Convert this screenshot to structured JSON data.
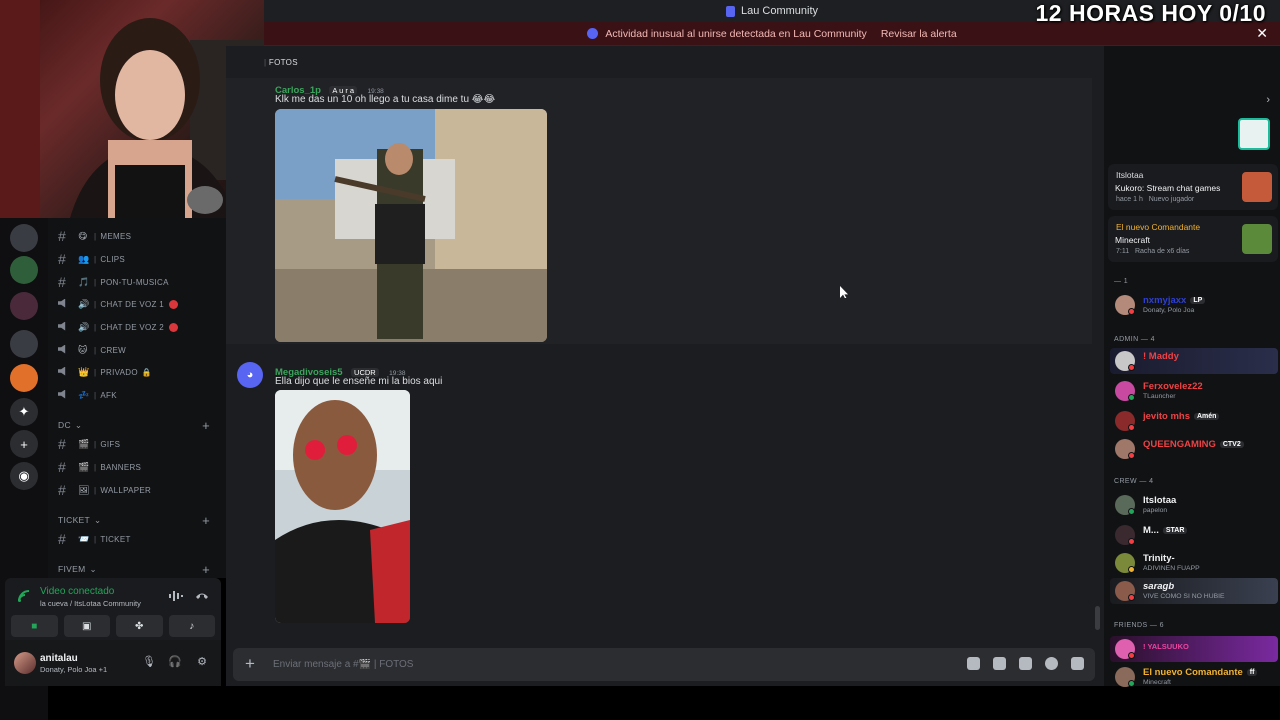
{
  "window": {
    "title": "Lau Community",
    "alert_text": "Actividad inusual al unirse detectada en Lau Community",
    "alert_link": "Revisar la alerta",
    "close_glyph": "✕"
  },
  "overlay": {
    "title": "12 HORAS HOY 0/10"
  },
  "channels": {
    "items": [
      {
        "type": "text",
        "emoji": "😋",
        "name": "MEMES"
      },
      {
        "type": "text",
        "emoji": "👥",
        "name": "CLIPS"
      },
      {
        "type": "text",
        "emoji": "🎵",
        "name": "PON-TU-MUSICA"
      },
      {
        "type": "voice",
        "emoji": "🔊",
        "name": "CHAT DE VOZ 1"
      },
      {
        "type": "voice",
        "emoji": "🔊",
        "name": "CHAT DE VOZ 2"
      },
      {
        "type": "voice",
        "emoji": "🐱",
        "name": "CREW"
      },
      {
        "type": "voice",
        "emoji": "👑",
        "name": "PRIVADO"
      },
      {
        "type": "voice",
        "emoji": "💤",
        "name": "AFK"
      }
    ],
    "categories": [
      {
        "name": "DC",
        "items": [
          {
            "emoji": "🎬",
            "name": "GIFS"
          },
          {
            "emoji": "🎬",
            "name": "BANNERS"
          },
          {
            "emoji": "🖼",
            "name": "WALLPAPER"
          }
        ]
      },
      {
        "name": "TICKET",
        "items": [
          {
            "emoji": "📨",
            "name": "TICKET"
          }
        ]
      },
      {
        "name": "FIVEM",
        "items": []
      }
    ]
  },
  "voice": {
    "status": "Video conectado",
    "channel": "la cueva / ItsLotaa Community"
  },
  "user": {
    "name": "anitalau",
    "activity": "Donaty, Polo Joa +1"
  },
  "channel_header": {
    "name": "FOTOS"
  },
  "messages": [
    {
      "author": "Carlos_1p",
      "author_color": "#3ba55c",
      "tag": "A u r a",
      "time": "19:38",
      "text": "Klk me das un 10 oh llego a tu casa dime tu 😂😂"
    },
    {
      "author": "Megadivoseis5",
      "author_color": "#3ba55c",
      "tag": "UCDR",
      "time": "19:38",
      "text": "Ella dijo que le enseñe mi la bios  aqui"
    }
  ],
  "input": {
    "placeholder": "Enviar mensaje a #🎬 | FOTOS"
  },
  "members": {
    "activities": [
      {
        "user": "Itslotaa",
        "game": "Kukoro: Stream chat games",
        "meta1": "hace 1 h",
        "meta2": "Nuevo jugador"
      },
      {
        "user": "El nuevo Comandante",
        "game": "Minecraft",
        "meta1": "7:11",
        "meta2": "Racha de x6 días"
      }
    ],
    "groups": [
      {
        "label": "— 1",
        "members": [
          {
            "name": "nxmyjaxx",
            "color": "#2e3fd6",
            "tag": "LP",
            "sub": "Donaty, Polo Joa"
          }
        ]
      },
      {
        "label": "ADMIN — 4",
        "members": [
          {
            "name": "! Maddy",
            "color": "#ed4245",
            "tag": "",
            "sub": ""
          },
          {
            "name": "Ferxovelez22",
            "color": "#ed4245",
            "tag": "",
            "sub": "TLauncher"
          },
          {
            "name": "jevito mhs",
            "color": "#ed4245",
            "tag": "Amén",
            "sub": ""
          },
          {
            "name": "QUEENGAMING",
            "color": "#ed4245",
            "tag": "CTV2",
            "sub": ""
          }
        ]
      },
      {
        "label": "CREW — 4",
        "members": [
          {
            "name": "Itslotaa",
            "color": "#f2f3f5",
            "tag": "",
            "sub": "papelon"
          },
          {
            "name": "M...",
            "color": "#f2f3f5",
            "tag": "STAR",
            "sub": ""
          },
          {
            "name": "Trinity-",
            "color": "#f2f3f5",
            "tag": "",
            "sub": "ADIVINEN FUAPP"
          },
          {
            "name": "saragb",
            "color": "#f2f3f5",
            "tag": "",
            "sub": "VIVE COMO SI NO HUBIE"
          }
        ]
      },
      {
        "label": "FRIENDS — 6",
        "members": [
          {
            "name": "! YALSUUKO",
            "color": "#eb459e",
            "tag": "",
            "sub": ""
          },
          {
            "name": "El nuevo Comandante",
            "color": "#f0b232",
            "tag": "ff",
            "sub": "Minecraft"
          }
        ]
      }
    ]
  },
  "colors": {
    "online": "#23a55a",
    "dnd": "#f23f43",
    "idle": "#f0b232",
    "accent": "#5865f2"
  }
}
